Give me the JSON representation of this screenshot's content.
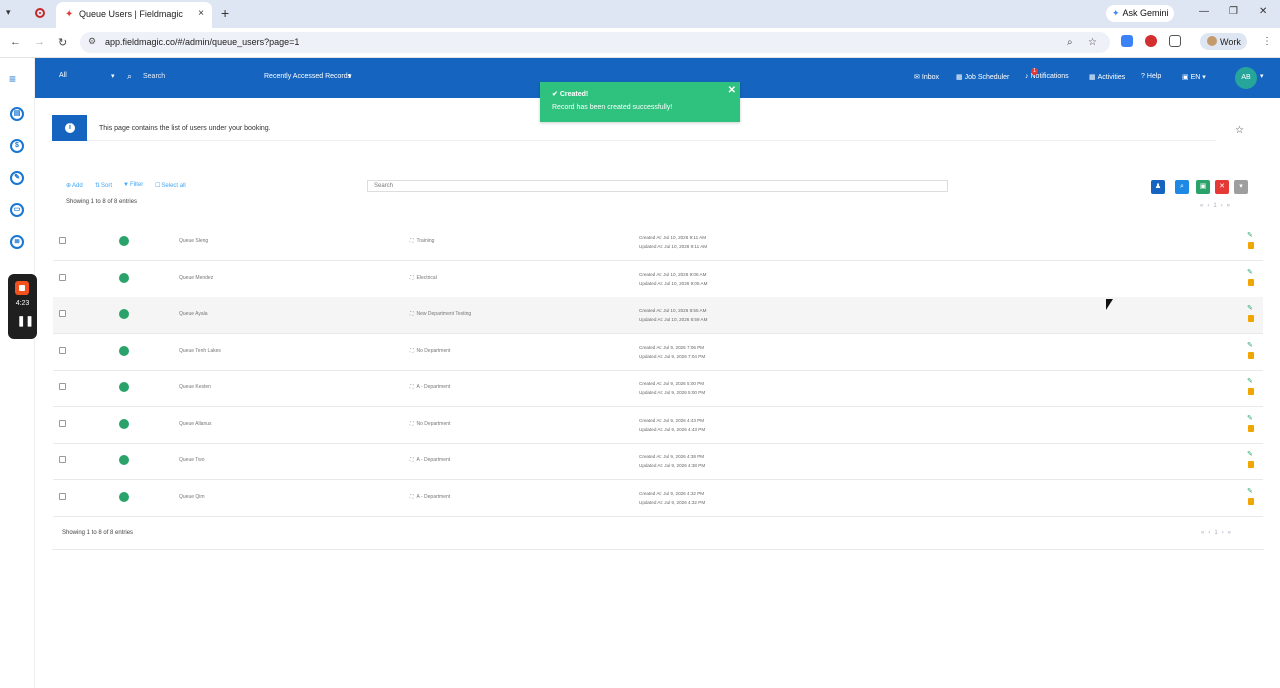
{
  "browser": {
    "tab_title": "Queue Users | Fieldmagic",
    "new_tab_glyph": "+",
    "tab_close_glyph": "×",
    "gemini_label": "Ask Gemini",
    "url": "app.fieldmagic.co/#/admin/queue_users?page=1",
    "profile_label": "Work"
  },
  "recorder": {
    "time": "4:23"
  },
  "header": {
    "scope_value": "All",
    "search_placeholder": "Search",
    "recent_label": "Recently Accessed Records",
    "nav": {
      "inbox": "Inbox",
      "job_scheduler": "Job Scheduler",
      "notifications": "Notifications",
      "notifications_count": "1",
      "activities": "Activities",
      "help": "Help",
      "language": "EN"
    },
    "avatar_initials": "AB"
  },
  "toast": {
    "title": "Created!",
    "message": "Record has been created successfully!"
  },
  "info": {
    "text": "This page contains the list of users under your booking."
  },
  "toolbar": {
    "add": "Add",
    "sort": "Sort",
    "filter": "Filter",
    "select_all": "Select all",
    "showing": "Showing 1 to 8 of 8 entries",
    "search_placeholder": "Search",
    "page": "1"
  },
  "rows": [
    {
      "name": "Queue Sleng",
      "department": "Training",
      "created": "Created At: Jul 10, 2026 9:11 AM",
      "updated": "Updated At: Jul 10, 2026 9:11 AM"
    },
    {
      "name": "Queue Mendez",
      "department": "Electrical",
      "created": "Created At: Jul 10, 2026 9:06 AM",
      "updated": "Updated At: Jul 10, 2026 9:05 AM"
    },
    {
      "name": "Queue Ayala",
      "department": "New Department Testing",
      "created": "Created At: Jul 10, 2026 8:55 AM",
      "updated": "Updated At: Jul 10, 2026 8:59 AM"
    },
    {
      "name": "Queue Tenh Lakes",
      "department": "No Department",
      "created": "Created At: Jul 9, 2026 7:06 PM",
      "updated": "Updated At: Jul 9, 2026 7:04 PM"
    },
    {
      "name": "Queue Kesten",
      "department": "A - Department",
      "created": "Created At: Jul 9, 2026 5:00 PM",
      "updated": "Updated At: Jul 9, 2026 5:00 PM"
    },
    {
      "name": "Queue Allanus",
      "department": "No Department",
      "created": "Created At: Jul 9, 2026 4:43 PM",
      "updated": "Updated At: Jul 9, 2026 4:43 PM"
    },
    {
      "name": "Queue Two",
      "department": "A - Department",
      "created": "Created At: Jul 9, 2026 4:38 PM",
      "updated": "Updated At: Jul 9, 2026 4:38 PM"
    },
    {
      "name": "Queue Qim",
      "department": "A - Department",
      "created": "Created At: Jul 9, 2026 4:32 PM",
      "updated": "Updated At: Jul 9, 2026 4:32 PM"
    }
  ],
  "footer": {
    "showing": "Showing 1 to 8 of 8 entries",
    "page": "1"
  },
  "colors": {
    "brand": "#1565c0",
    "success": "#2ec27e",
    "status_active": "#2aa36b",
    "delete": "#e53935",
    "warning": "#f0a500"
  },
  "icons": {
    "sidebar": [
      "menu-icon",
      "clipboard-icon",
      "dollar-icon",
      "wrench-icon",
      "briefcase-icon",
      "database-icon"
    ],
    "toolbar_buttons": [
      "user-icon",
      "search-icon",
      "save-icon",
      "close-icon",
      "caret-icon"
    ]
  }
}
